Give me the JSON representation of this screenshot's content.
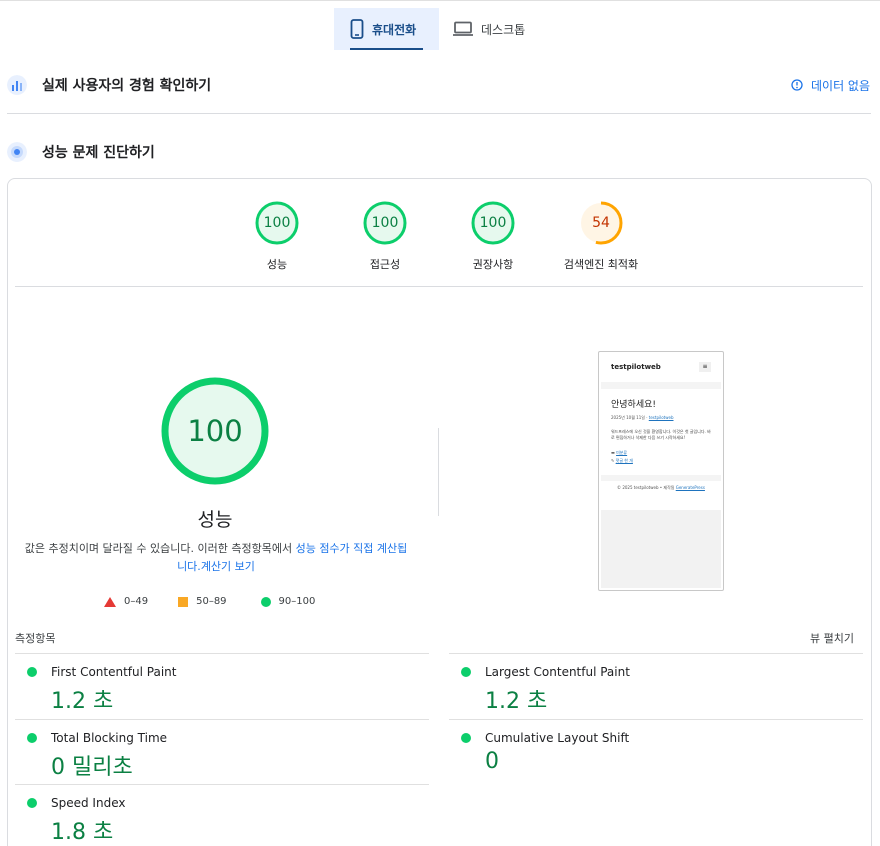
{
  "device_tabs": {
    "mobile_label": "휴대전화",
    "desktop_label": "데스크톱"
  },
  "field_section": {
    "title": "실제 사용자의 경험 확인하기",
    "no_data_label": "데이터 없음"
  },
  "diagnose_section": {
    "title": "성능 문제 진단하기"
  },
  "categories": [
    {
      "label": "성능",
      "score": "100",
      "rating": "pass"
    },
    {
      "label": "접근성",
      "score": "100",
      "rating": "pass"
    },
    {
      "label": "권장사항",
      "score": "100",
      "rating": "pass"
    },
    {
      "label": "검색엔진 최적화",
      "score": "54",
      "rating": "average"
    }
  ],
  "performance": {
    "score": "100",
    "title": "성능",
    "desc_prefix": "값은 추정치이며 달라질 수 있습니다. 이러한 측정항목에서 ",
    "desc_link1": "성능 점수가 직접 계산됩니다.",
    "desc_link2": "계산기 보기"
  },
  "legend": {
    "fail": "0–49",
    "average": "50–89",
    "pass": "90–100"
  },
  "preview": {
    "site_name": "testpilotweb",
    "menu_icon": "≡",
    "heading": "안녕하세요!",
    "meta_date": "2025년 10월 11일 · ",
    "meta_author": "testpilotweb",
    "body": "워드프레스에 오신 것을 환영합니다. 이것은 첫 글입니다. 바로 편집하거나 삭제한 다음 쓰기 시작하세요!",
    "category": "미분류",
    "comment": "댓글 한 개",
    "footer_prefix": "© 2025 testpilotweb • 제작됨 ",
    "footer_link": "GeneratePress"
  },
  "metrics": {
    "label": "측정항목",
    "expand_label": "뷰 펼치기",
    "items": [
      {
        "name": "First Contentful Paint",
        "value": "1.2 초"
      },
      {
        "name": "Largest Contentful Paint",
        "value": "1.2 초"
      },
      {
        "name": "Total Blocking Time",
        "value": "0 밀리초"
      },
      {
        "name": "Cumulative Layout Shift",
        "value": "0"
      },
      {
        "name": "Speed Index",
        "value": "1.8 초"
      }
    ]
  },
  "colors": {
    "pass": "#0cce6b",
    "pass_text": "#0b8043",
    "average": "#ffa400",
    "average_text": "#c33300",
    "fail": "#ff4e42",
    "link": "#1a73e8"
  }
}
